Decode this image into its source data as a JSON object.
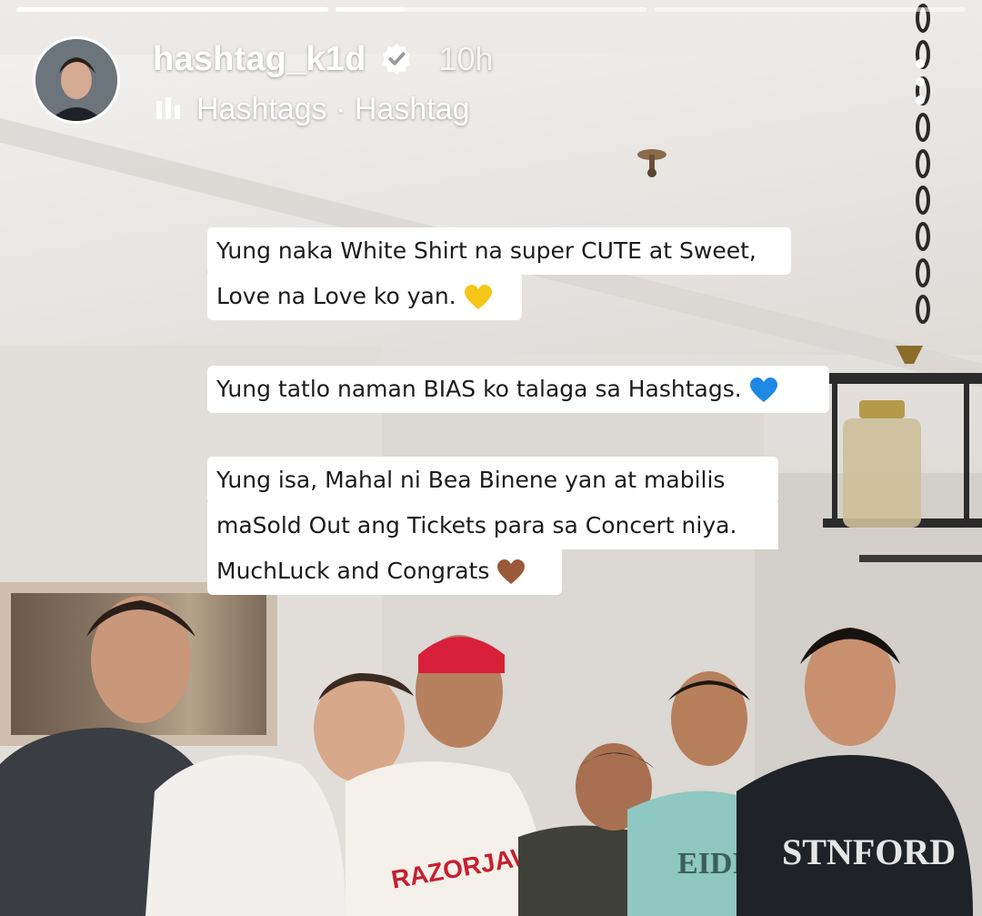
{
  "story": {
    "progress": [
      1.0,
      0.22,
      0.0
    ],
    "username": "hashtag_k1d",
    "verified": true,
    "time_ago": "10h",
    "music_icon": "music-bars-icon",
    "subtitle": "Hashtags · Hashtag",
    "more_icon": "more-vertical-icon"
  },
  "text_overlays": [
    {
      "lines": [
        "Yung naka White Shirt na super CUTE at Sweet,",
        "Love na Love ko yan."
      ],
      "emoji": "yellow-heart",
      "emoji_color": "#f5c518"
    },
    {
      "lines": [
        "Yung tatlo naman BIAS ko talaga sa Hashtags."
      ],
      "emoji": "blue-heart",
      "emoji_color": "#1e88e5"
    },
    {
      "lines": [
        "Yung isa, Mahal ni Bea Binene yan at mabilis",
        "maSold Out ang Tickets para sa Concert niya.",
        "MuchLuck and Congrats"
      ],
      "emoji": "brown-heart",
      "emoji_color": "#9a5a3a"
    }
  ],
  "shirt_texts": {
    "red_shirt": "RAZORJAW",
    "teal_shirt": "EIDII",
    "black_jacket": "STNFORD"
  }
}
